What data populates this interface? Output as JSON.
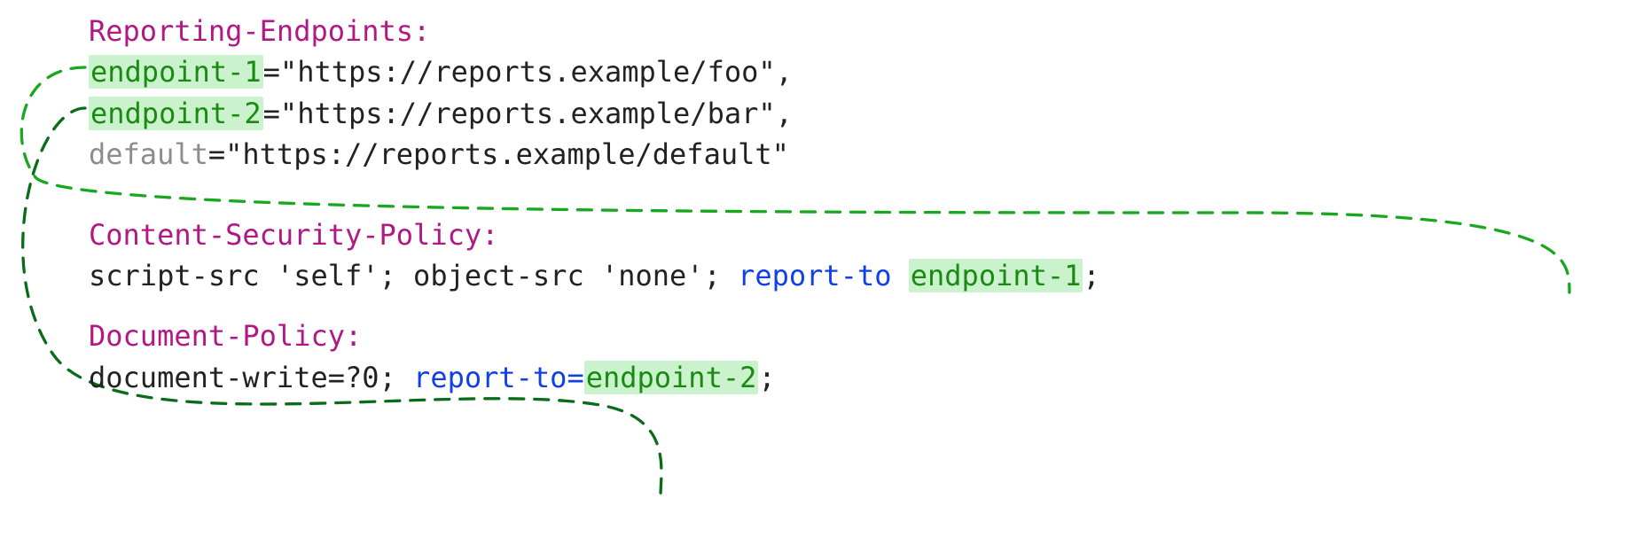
{
  "headers": {
    "reporting": {
      "name": "Reporting-Endpoints:",
      "e1": {
        "key": "endpoint-1",
        "eq": "=",
        "url": "\"https://reports.example/foo\"",
        "trail": ","
      },
      "e2": {
        "key": "endpoint-2",
        "eq": "=",
        "url": "\"https://reports.example/bar\"",
        "trail": ","
      },
      "def": {
        "key": "default",
        "eq": "=",
        "url": "\"https://reports.example/default\""
      }
    },
    "csp": {
      "name": "Content-Security-Policy:",
      "body_before": "script-src 'self'; object-src 'none'; ",
      "report": "report-to",
      "space": " ",
      "target": "endpoint-1",
      "trail": ";"
    },
    "dp": {
      "name": "Document-Policy:",
      "body_before": "document-write=?0; ",
      "report": "report-to=",
      "target": "endpoint-2",
      "trail": ";"
    }
  },
  "connectors": {
    "color1": "#18a71f",
    "color2": "#0a6b18"
  }
}
